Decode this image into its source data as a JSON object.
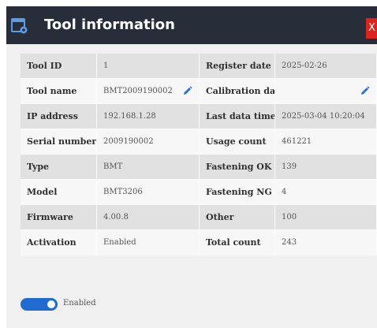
{
  "dialog": {
    "title": "Tool information",
    "close_label": "X",
    "icon": "window-settings-icon",
    "colors": {
      "titlebar": "#272e39",
      "close": "#e0221c",
      "accent": "#1f6bd1"
    }
  },
  "rows": [
    {
      "left_label": "Tool ID",
      "left_value": "1",
      "left_edit": false,
      "right_label": "Register date",
      "right_value": "2025-02-26",
      "right_edit": false
    },
    {
      "left_label": "Tool name",
      "left_value": "BMT2009190002",
      "left_edit": true,
      "right_label": "Calibration date",
      "right_value": "",
      "right_edit": true
    },
    {
      "left_label": "IP address",
      "left_value": "192.168.1.28",
      "left_edit": false,
      "right_label": "Last data time",
      "right_value": "2025-03-04 10:20:04",
      "right_edit": false
    },
    {
      "left_label": "Serial number",
      "left_value": "2009190002",
      "left_edit": false,
      "right_label": "Usage count",
      "right_value": "461221",
      "right_edit": false
    },
    {
      "left_label": "Type",
      "left_value": "BMT",
      "left_edit": false,
      "right_label": "Fastening OK",
      "right_value": "139",
      "right_edit": false
    },
    {
      "left_label": "Model",
      "left_value": "BMT3206",
      "left_edit": false,
      "right_label": "Fastening NG",
      "right_value": "4",
      "right_edit": false
    },
    {
      "left_label": "Firmware",
      "left_value": "4.00.8",
      "left_edit": false,
      "right_label": "Other",
      "right_value": "100",
      "right_edit": false
    },
    {
      "left_label": "Activation",
      "left_value": "Enabled",
      "left_edit": false,
      "right_label": "Total count",
      "right_value": "243",
      "right_edit": false
    }
  ],
  "toggle": {
    "label": "Enabled",
    "on": true
  }
}
